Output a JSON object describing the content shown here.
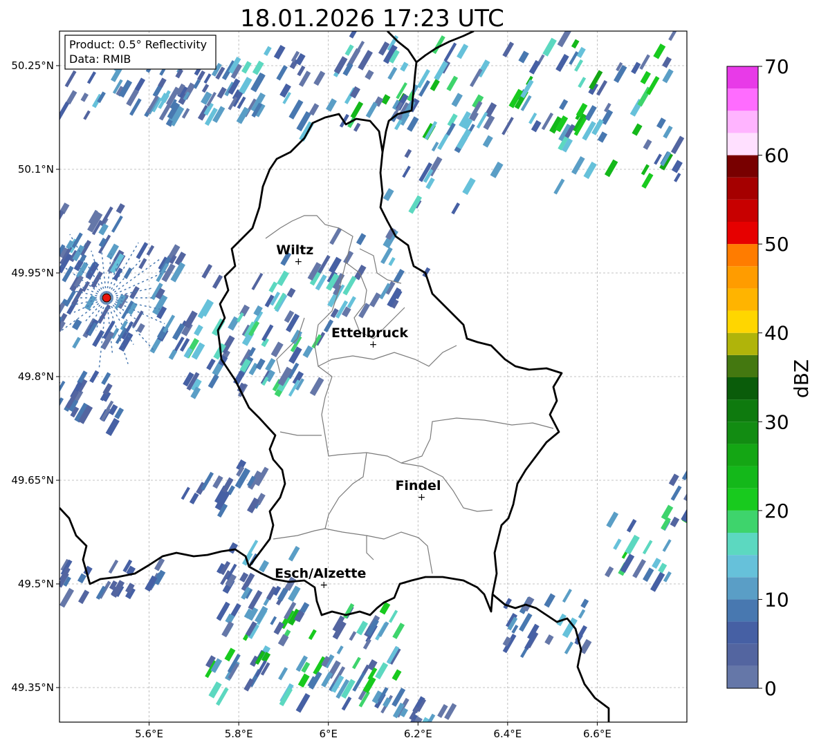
{
  "title": "18.01.2026 17:23 UTC",
  "info_box": {
    "product": "Product: 0.5° Reflectivity",
    "data": "Data: RMIB"
  },
  "map": {
    "lon_range": [
      5.4,
      6.8
    ],
    "lat_range": [
      49.3,
      50.3
    ],
    "lon_ticks": [
      {
        "value": 5.6,
        "label": "5.6°E"
      },
      {
        "value": 5.8,
        "label": "5.8°E"
      },
      {
        "value": 6.0,
        "label": "6°E"
      },
      {
        "value": 6.2,
        "label": "6.2°E"
      },
      {
        "value": 6.4,
        "label": "6.4°E"
      },
      {
        "value": 6.6,
        "label": "6.6°E"
      }
    ],
    "lat_ticks": [
      {
        "value": 50.25,
        "label": "50.25°N"
      },
      {
        "value": 50.1,
        "label": "50.1°N"
      },
      {
        "value": 49.95,
        "label": "49.95°N"
      },
      {
        "value": 49.8,
        "label": "49.8°N"
      },
      {
        "value": 49.65,
        "label": "49.65°N"
      },
      {
        "value": 49.5,
        "label": "49.5°N"
      },
      {
        "value": 49.35,
        "label": "49.35°N"
      }
    ],
    "grid": true,
    "radar_site": {
      "lon": 5.505,
      "lat": 49.914,
      "color": "#e8140c"
    },
    "cities": [
      {
        "name": "Wiltz",
        "lon": 5.933,
        "lat": 49.967
      },
      {
        "name": "Ettelbruck",
        "lon": 6.1,
        "lat": 49.847
      },
      {
        "name": "Findel",
        "lon": 6.208,
        "lat": 49.626
      },
      {
        "name": "Esch/Alzette",
        "lon": 5.99,
        "lat": 49.499
      }
    ]
  },
  "colorbar": {
    "label": "dBZ",
    "min": 0,
    "max": 70,
    "step": 2.5,
    "ticks": [
      {
        "value": 0,
        "label": "0"
      },
      {
        "value": 10,
        "label": "10"
      },
      {
        "value": 20,
        "label": "20"
      },
      {
        "value": 30,
        "label": "30"
      },
      {
        "value": 40,
        "label": "40"
      },
      {
        "value": 50,
        "label": "50"
      },
      {
        "value": 60,
        "label": "60"
      },
      {
        "value": 70,
        "label": "70"
      }
    ],
    "colors": [
      "#6577a8",
      "#5365a0",
      "#4660a4",
      "#4878b0",
      "#5a9ec6",
      "#66c1da",
      "#5cd8c0",
      "#3ed46c",
      "#18ca1e",
      "#14b81a",
      "#14a614",
      "#128c12",
      "#0e7a0e",
      "#0a5c0a",
      "#447810",
      "#b0b40a",
      "#ffd600",
      "#ffb400",
      "#ff9c00",
      "#ff7c00",
      "#e60000",
      "#c80000",
      "#a50000",
      "#780000",
      "#ffe0ff",
      "#ffb4ff",
      "#ff6cff",
      "#e83ae8"
    ]
  }
}
